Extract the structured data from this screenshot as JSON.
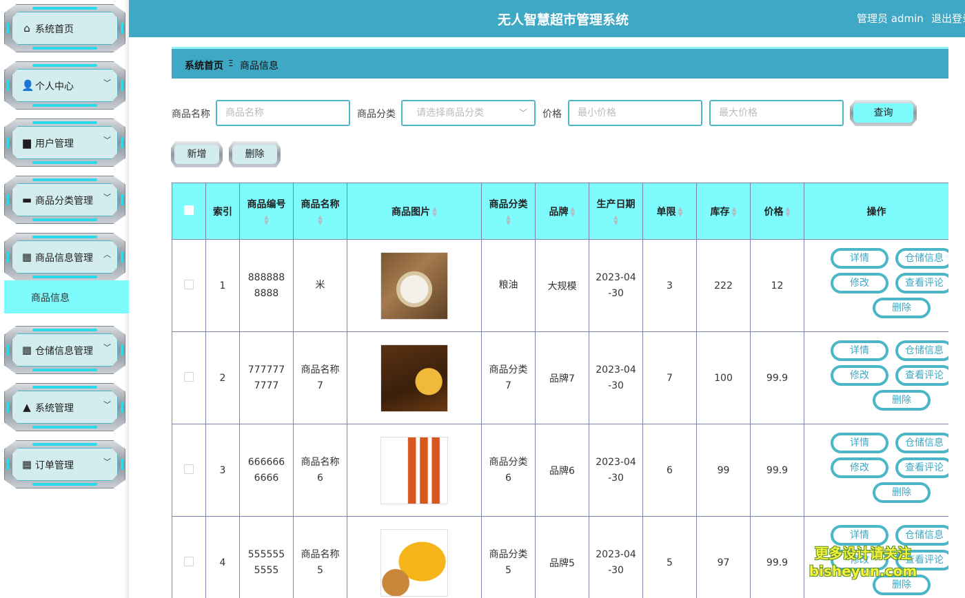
{
  "app": {
    "title": "无人智慧超市管理系统",
    "user": "管理员 admin",
    "logout": "退出登录"
  },
  "sidebar": {
    "items": [
      {
        "label": "系统首页",
        "icon": "home-icon",
        "glyph": "⌂",
        "has_chevron": false,
        "open": false
      },
      {
        "label": "个人中心",
        "icon": "user-icon",
        "glyph": "👤",
        "has_chevron": true,
        "open": false
      },
      {
        "label": "用户管理",
        "icon": "brush-icon",
        "glyph": "▆",
        "has_chevron": true,
        "open": false
      },
      {
        "label": "商品分类管理",
        "icon": "chat-icon",
        "glyph": "▬",
        "has_chevron": true,
        "open": false
      },
      {
        "label": "商品信息管理",
        "icon": "grid-icon",
        "glyph": "▦",
        "has_chevron": true,
        "open": true
      },
      {
        "label": "仓储信息管理",
        "icon": "grid-icon",
        "glyph": "▦",
        "has_chevron": true,
        "open": false
      },
      {
        "label": "系统管理",
        "icon": "admin-user-icon",
        "glyph": "▲",
        "has_chevron": true,
        "open": false
      },
      {
        "label": "订单管理",
        "icon": "grid-icon",
        "glyph": "▦",
        "has_chevron": true,
        "open": false
      }
    ],
    "active_submenu": "商品信息"
  },
  "breadcrumb": {
    "home": "系统首页",
    "separator": "Ξ",
    "current": "商品信息"
  },
  "search": {
    "name_label": "商品名称",
    "name_placeholder": "商品名称",
    "category_label": "商品分类",
    "category_placeholder": "请选择商品分类",
    "price_label": "价格",
    "min_placeholder": "最小价格",
    "max_placeholder": "最大价格",
    "query_button": "查询"
  },
  "toolbar": {
    "add_button": "新增",
    "delete_button": "删除"
  },
  "table": {
    "headers": [
      "索引",
      "商品编号",
      "商品名称",
      "商品图片",
      "商品分类",
      "品牌",
      "生产日期",
      "单限",
      "库存",
      "价格",
      "操作"
    ],
    "rows": [
      {
        "index": "1",
        "code": "8888888888",
        "name": "米",
        "image": "rice-sack",
        "category": "粮油",
        "brand": "大规模",
        "date": "2023-04-30",
        "limit": "3",
        "stock": "222",
        "price": "12"
      },
      {
        "index": "2",
        "code": "7777777777",
        "name": "商品名称7",
        "image": "peanut-oil",
        "category": "商品分类7",
        "brand": "品牌7",
        "date": "2023-04-30",
        "limit": "7",
        "stock": "100",
        "price": "99.9"
      },
      {
        "index": "3",
        "code": "6666666666",
        "name": "商品名称6",
        "image": "cooking-wine",
        "category": "商品分类6",
        "brand": "品牌6",
        "date": "2023-04-30",
        "limit": "6",
        "stock": "99",
        "price": "99.9"
      },
      {
        "index": "4",
        "code": "5555555555",
        "name": "商品名称5",
        "image": "millet-bag",
        "category": "商品分类5",
        "brand": "品牌5",
        "date": "2023-04-30",
        "limit": "5",
        "stock": "97",
        "price": "99.9"
      }
    ],
    "row_actions": {
      "detail": "详情",
      "storage": "仓储信息",
      "edit": "修改",
      "reviews": "查看评论",
      "delete": "删除"
    }
  },
  "watermark": {
    "line1": "更多设计请关注",
    "line2": "bisheyun.com"
  },
  "colors": {
    "header": "#3ea8c5",
    "accent": "#7dfbfd",
    "border": "#4bb6c7"
  }
}
